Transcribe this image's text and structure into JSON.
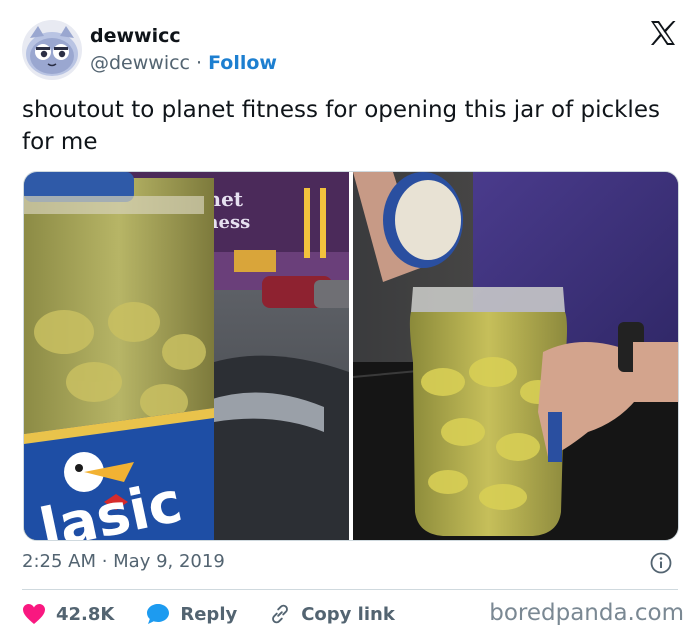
{
  "author": {
    "display_name": "dewwicc",
    "handle": "@dewwicc",
    "separator": "·",
    "follow_label": "Follow"
  },
  "tweet": {
    "text": "shoutout to planet fitness for opening this jar of pickles for me",
    "timestamp": "2:25 AM · May 9, 2019"
  },
  "media": {
    "left_sign_line1": "planet",
    "left_sign_line2": "fitness",
    "left_label_text": "lasic"
  },
  "actions": {
    "like_count": "42.8K",
    "reply_label": "Reply",
    "copy_label": "Copy link"
  },
  "watermark": "boredpanda.com",
  "colors": {
    "link": "#1d7fd0",
    "like": "#f91880",
    "reply": "#1d9bf0",
    "muted": "#536471"
  },
  "icons": [
    "x-logo-icon",
    "info-icon",
    "heart-icon",
    "reply-bubble-icon",
    "link-icon"
  ]
}
